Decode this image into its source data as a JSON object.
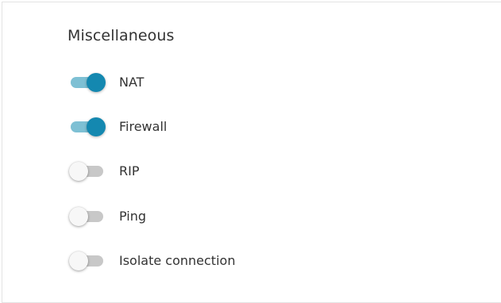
{
  "section": {
    "title": "Miscellaneous"
  },
  "toggles": [
    {
      "label": "NAT",
      "checked": true
    },
    {
      "label": "Firewall",
      "checked": true
    },
    {
      "label": "RIP",
      "checked": false
    },
    {
      "label": "Ping",
      "checked": false
    },
    {
      "label": "Isolate connection",
      "checked": false
    }
  ],
  "colors": {
    "accent": "#1488b0",
    "accent_track": "#7ec0d4",
    "off_track": "#c8c8c8",
    "off_thumb": "#f7f7f7",
    "text": "#333333",
    "border": "#e3e3e3"
  }
}
